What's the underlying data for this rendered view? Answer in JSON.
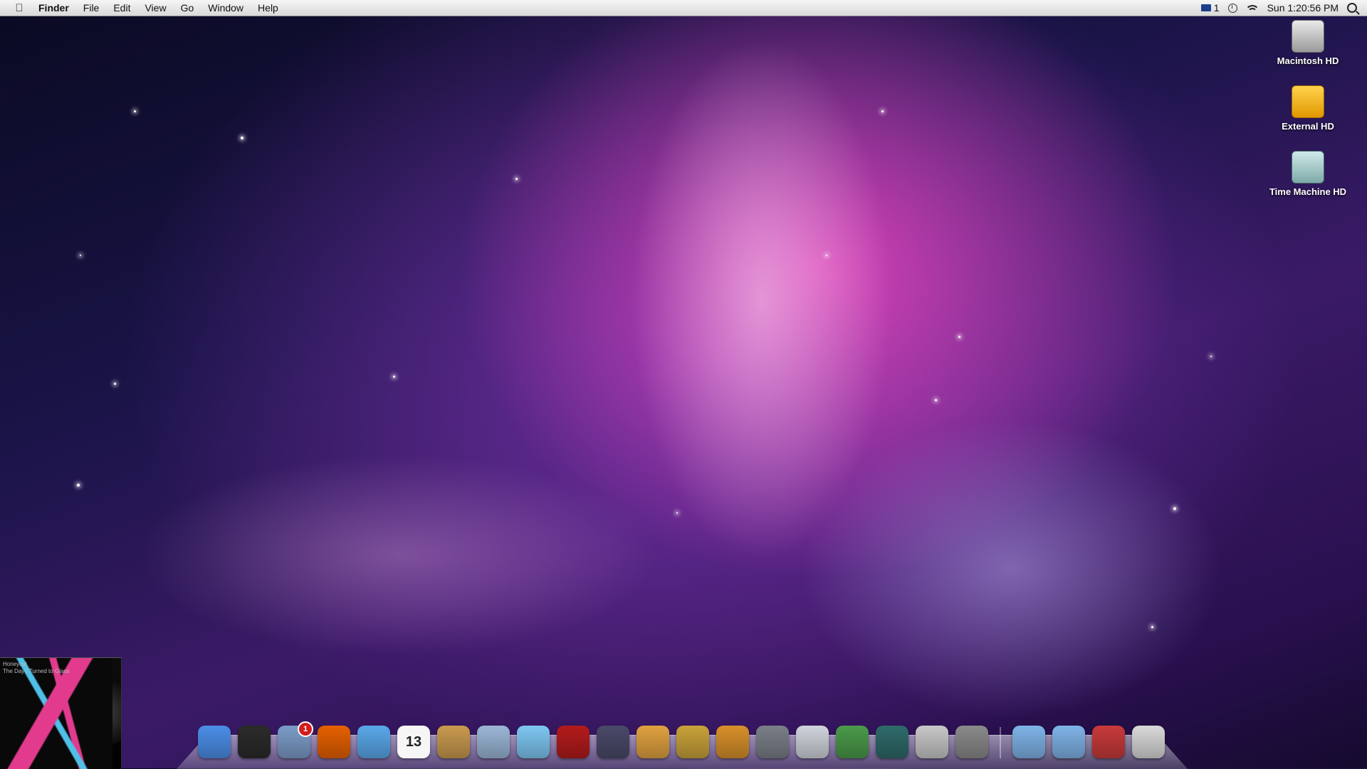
{
  "menubar": {
    "app_name": "Finder",
    "menus": [
      "File",
      "Edit",
      "View",
      "Go",
      "Window",
      "Help"
    ],
    "mail_count": "1",
    "clock": "Sun 1:20:56 PM"
  },
  "desktop_icons": [
    {
      "label": "Macintosh HD",
      "icon": "hard-drive-icon"
    },
    {
      "label": "External HD",
      "icon": "usb-drive-icon"
    },
    {
      "label": "Time Machine HD",
      "icon": "time-machine-drive-icon"
    }
  ],
  "now_playing": {
    "artist": "Honeycut",
    "album": "The Day I Turned to Glass"
  },
  "dock": {
    "apps": [
      {
        "name": "finder-icon",
        "color": "#4c8ee8"
      },
      {
        "name": "dashboard-icon",
        "color": "#2b2b2b"
      },
      {
        "name": "mail-icon",
        "color": "#7c9cc8",
        "badge": "1"
      },
      {
        "name": "firefox-icon",
        "color": "#e66000"
      },
      {
        "name": "ichat-icon",
        "color": "#5aa8ea"
      },
      {
        "name": "ical-icon",
        "color": "#f4f4f4",
        "text": "13"
      },
      {
        "name": "address-book-icon",
        "color": "#c99a4f"
      },
      {
        "name": "preview-icon",
        "color": "#9bb7d6"
      },
      {
        "name": "itunes-icon",
        "color": "#7ec7f2"
      },
      {
        "name": "front-row-icon",
        "color": "#b31b1b"
      },
      {
        "name": "quicktime-icon",
        "color": "#4a4a6a"
      },
      {
        "name": "iphoto-icon",
        "color": "#e0a240"
      },
      {
        "name": "imovie-icon",
        "color": "#c9a23a"
      },
      {
        "name": "garageband-icon",
        "color": "#d8902a"
      },
      {
        "name": "keynote-icon",
        "color": "#7a7f88"
      },
      {
        "name": "pages-icon",
        "color": "#d0d4dc"
      },
      {
        "name": "numbers-icon",
        "color": "#4a9a4a"
      },
      {
        "name": "time-machine-icon",
        "color": "#2f6a6a"
      },
      {
        "name": "script-editor-icon",
        "color": "#c8c8c8"
      },
      {
        "name": "system-preferences-icon",
        "color": "#8a8a8a"
      }
    ],
    "stacks": [
      {
        "name": "applications-folder-icon",
        "color": "#7fb3e8"
      },
      {
        "name": "documents-folder-icon",
        "color": "#7fb3e8"
      },
      {
        "name": "network-utility-icon",
        "color": "#c93a3a"
      },
      {
        "name": "trash-icon",
        "color": "#d9d9d9"
      }
    ]
  }
}
